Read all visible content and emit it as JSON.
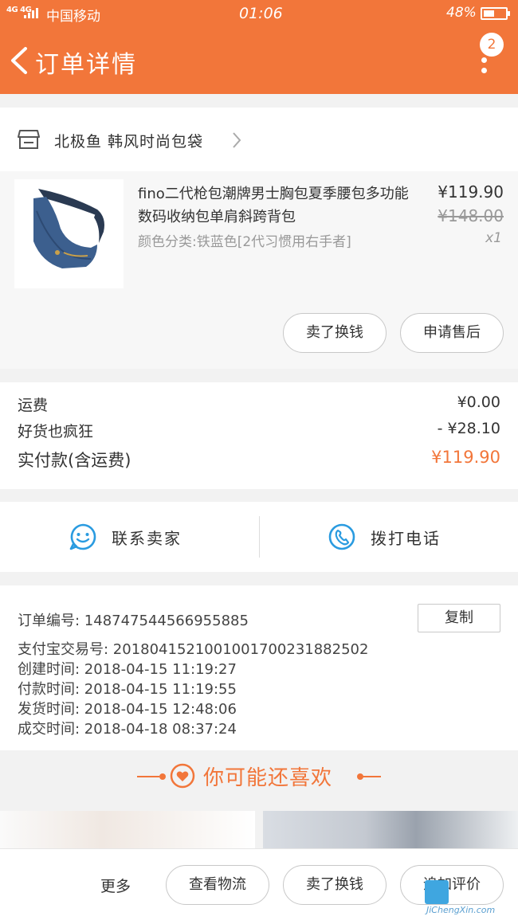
{
  "status_bar": {
    "network": "4G 4G",
    "carrier": "中国移动",
    "time": "01:06",
    "battery": "48%"
  },
  "app_bar": {
    "title": "订单详情",
    "message_count": "2"
  },
  "shop": {
    "name": "北极鱼 韩风时尚包袋"
  },
  "product": {
    "name": "fino二代枪包潮牌男士胸包夏季腰包多功能数码收纳包单肩斜跨背包",
    "sku": "颜色分类:铁蓝色[2代习惯用右手者]",
    "price": "¥119.90",
    "original_price": "¥148.00",
    "quantity": "x1",
    "buttons": {
      "buy_again": "卖了换钱",
      "after_sale": "申请售后"
    }
  },
  "costs": {
    "shipping_label": "运费",
    "shipping_value": "¥0.00",
    "discount_label": "好货也疯狂",
    "discount_value": "- ¥28.10",
    "paid_label": "实付款(含运费)",
    "paid_value": "¥119.90"
  },
  "contact": {
    "seller": "联系卖家",
    "call": "拨打电话"
  },
  "order_info": {
    "copy": "复制",
    "order_no": "订单编号:  1487475445669558​85",
    "alipay_no": "支付宝交易号:  2018041521001001700231882502",
    "created": "创建时间:  2018-04-15 11:19:27",
    "paid": "付款时间:  2018-04-15 11:19:55",
    "shipped": "发货时间:  2018-04-15 12:48:06",
    "completed": "成交时间:  2018-04-18 08:37:24"
  },
  "recommend": {
    "title": "你可能还喜欢"
  },
  "bottom_bar": {
    "more": "更多",
    "logistics": "查看物流",
    "buy_again": "卖了换钱",
    "review": "追加评价"
  },
  "watermark": {
    "text": "JiChengXin.com"
  },
  "colors": {
    "accent": "#f2763a",
    "contact_icon": "#2a9be0"
  }
}
